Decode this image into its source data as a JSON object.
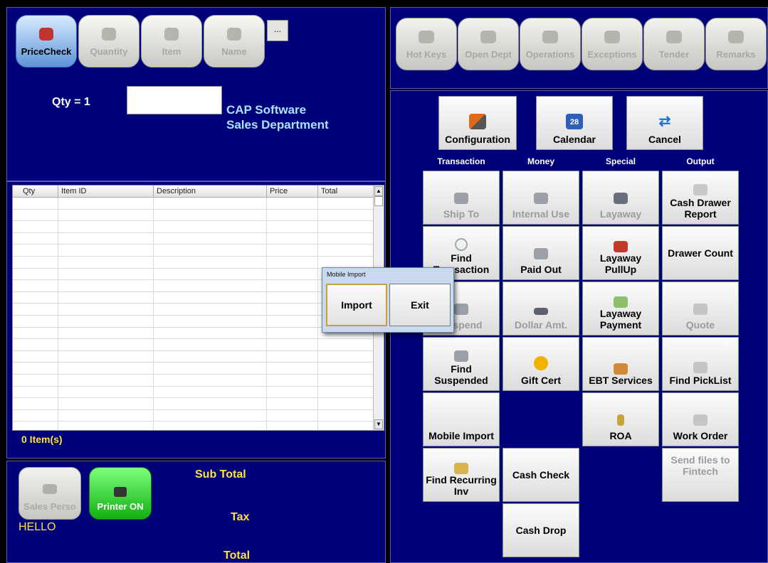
{
  "mode_tabs": [
    {
      "label": "PriceCheck",
      "icon": "barcode-icon"
    },
    {
      "label": "Quantity",
      "icon": "box-icon"
    },
    {
      "label": "Item",
      "icon": "tag-icon"
    },
    {
      "label": "Name",
      "icon": "person-icon"
    }
  ],
  "ellipsis_label": "...",
  "qty_label": "Qty = 1",
  "scan_input_value": "",
  "company": {
    "line1": "CAP Software",
    "line2": "Sales Department"
  },
  "grid": {
    "columns": [
      "Qty",
      "Item ID",
      "Description",
      "Price",
      "Total"
    ],
    "row_count": 20
  },
  "item_count": "0  Item(s)",
  "sales_person_label": "Sales Perso",
  "printer_label": "Printer ON",
  "hello_text": "HELLO",
  "totals": {
    "sub_total": "Sub Total",
    "tax": "Tax",
    "total": "Total"
  },
  "top_tabs": [
    {
      "label": "Hot Keys",
      "icon": "keys-icon"
    },
    {
      "label": "Open Dept",
      "icon": "house-icon"
    },
    {
      "label": "Operations",
      "icon": "gears-icon"
    },
    {
      "label": "Exceptions",
      "icon": "document-icon"
    },
    {
      "label": "Tender",
      "icon": "money-bag-icon"
    },
    {
      "label": "Remarks",
      "icon": "speech-bubble-icon"
    }
  ],
  "top_buttons": {
    "configuration": "Configuration",
    "calendar": "Calendar",
    "calendar_day": "28",
    "cancel": "Cancel"
  },
  "column_headers": {
    "transaction": "Transaction",
    "money": "Money",
    "special": "Special",
    "output": "Output"
  },
  "buttons": {
    "ship_to": "Ship To",
    "internal_use": "Internal Use",
    "layaway": "Layaway",
    "cash_drawer_report": "Cash Drawer Report",
    "find_transaction": "Find Transaction",
    "paid_out": "Paid Out",
    "layaway_pullup": "Layaway PullUp",
    "drawer_count": "Drawer Count",
    "suspend": "Suspend",
    "dollar_amt": "Dollar Amt.",
    "layaway_payment": "Layaway Payment",
    "quote": "Quote",
    "find_suspended": "Find Suspended",
    "gift_cert": "Gift Cert",
    "ebt_services": "EBT Services",
    "find_picklist": "Find PickList",
    "mobile_import": "Mobile Import",
    "roa": "ROA",
    "work_order": "Work Order",
    "find_recurring_inv": "Find Recurring Inv",
    "cash_check": "Cash Check",
    "send_files_fintech": "Send files to Fintech",
    "cash_drop": "Cash Drop"
  },
  "dialog": {
    "title": "Mobile Import",
    "import": "Import",
    "exit": "Exit"
  }
}
